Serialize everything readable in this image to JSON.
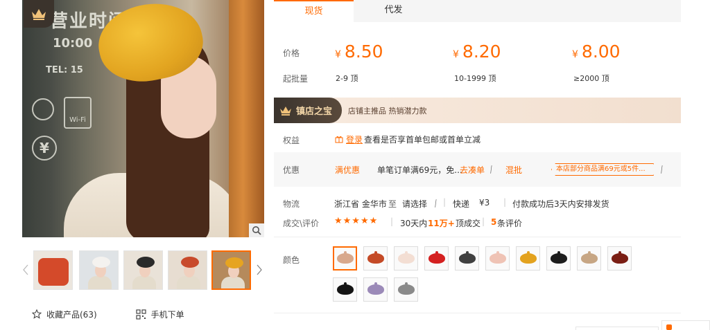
{
  "gallery": {
    "main_image_alt": "",
    "thumbnails": [
      {
        "bg": "#ece6de",
        "hat": "#d44a2a"
      },
      {
        "bg": "#dfe3e6",
        "hat": "#f4f2ef"
      },
      {
        "bg": "#e9e2d8",
        "hat": "#2a2a2a"
      },
      {
        "bg": "#e7ddd1",
        "hat": "#c84a2c"
      },
      {
        "bg": "#b58a5c",
        "hat": "#e6a421"
      }
    ],
    "active_thumbnail": 4
  },
  "actions": {
    "favorite_label": "收藏产品(63)",
    "mobile_order_label": "手机下单"
  },
  "tabs": {
    "items": [
      {
        "label": "现货",
        "active": true
      },
      {
        "label": "代发",
        "active": false
      }
    ]
  },
  "pricing": {
    "price_label": "价格",
    "moq_label": "起批量",
    "currency": "¥",
    "tiers": [
      {
        "price": "8.50",
        "range": "2-9 顶"
      },
      {
        "price": "8.20",
        "range": "10-1999 顶"
      },
      {
        "price": "8.00",
        "range": "≥2000 顶"
      }
    ]
  },
  "banner": {
    "tag": "镇店之宝",
    "text": "店铺主推品   热销潜力款"
  },
  "rights": {
    "label": "权益",
    "login_link": "登录",
    "text": "查看是否享首单包邮或首单立减"
  },
  "promo": {
    "label": "优惠",
    "tag": "满优惠",
    "text": "单笔订单满69元，免...",
    "go_link": "去凑单",
    "mix_link": "混批",
    "chip": "本店部分商品满69元或5件..."
  },
  "logistics": {
    "label": "物流",
    "origin": "浙江省 金华市",
    "to": "至",
    "dest_select": "请选择",
    "method": "快递",
    "fee": "¥3",
    "dispatch": "付款成功后3天内安排发货"
  },
  "deal": {
    "label": "成交\\评价",
    "stars": "★★★★★",
    "period": "30天内",
    "count": "11万+",
    "count_unit": "顶成交",
    "reviews_num": "5",
    "reviews_unit": "条评价"
  },
  "colors": {
    "label": "颜色",
    "selected_index": 0,
    "swatches": [
      {
        "color": "#d8a88c"
      },
      {
        "color": "#c44a26"
      },
      {
        "color": "#f3ded3"
      },
      {
        "color": "#d42020"
      },
      {
        "color": "#404040"
      },
      {
        "color": "#efc3b5"
      },
      {
        "color": "#e3a21e"
      },
      {
        "color": "#1c1c1c"
      },
      {
        "color": "#c7a684"
      },
      {
        "color": "#7a1e14"
      },
      {
        "color": "#141414"
      },
      {
        "color": "#9b8ab8"
      },
      {
        "color": "#8a8a8a"
      }
    ]
  }
}
